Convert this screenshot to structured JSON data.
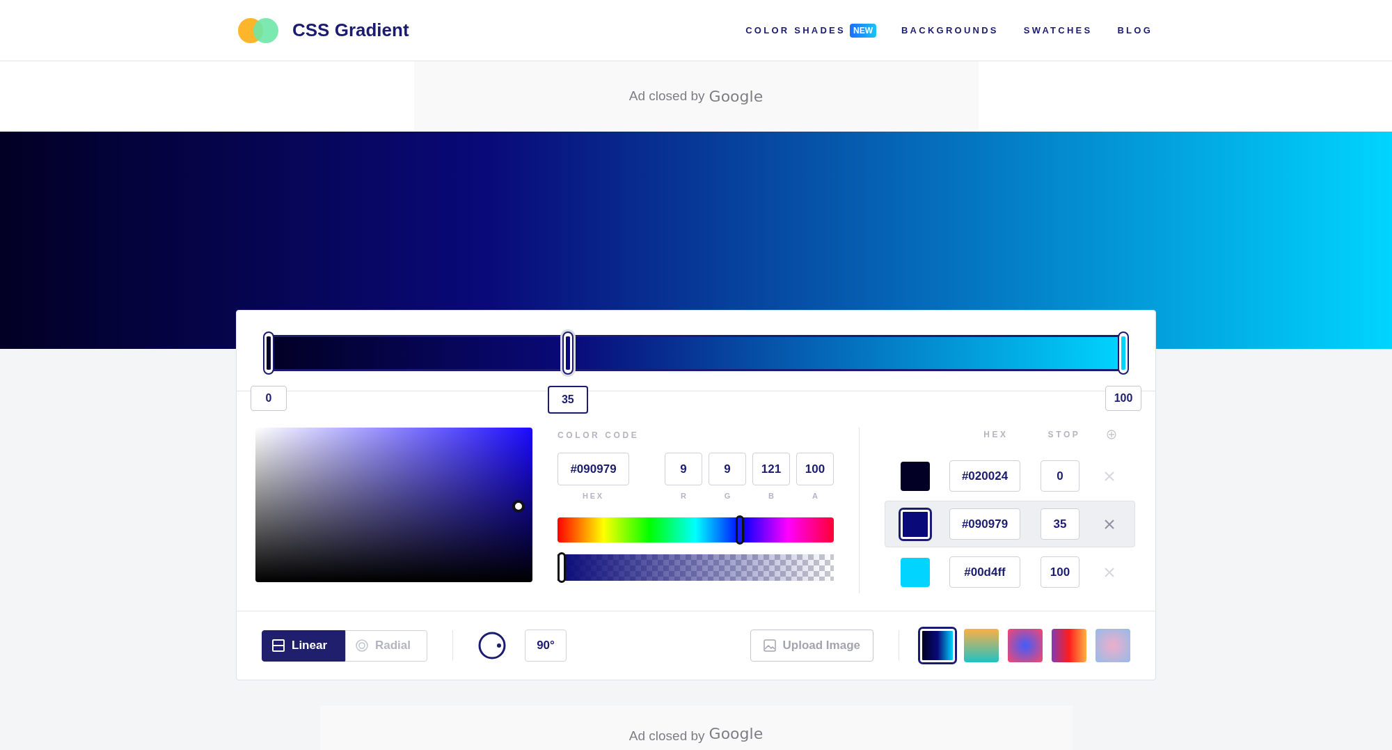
{
  "header": {
    "logo_text": "CSS Gradient",
    "nav": [
      {
        "label": "COLOR SHADES",
        "badge": "NEW"
      },
      {
        "label": "BACKGROUNDS"
      },
      {
        "label": "SWATCHES"
      },
      {
        "label": "BLOG"
      }
    ]
  },
  "ads": [
    {
      "text": "Ad closed by",
      "brand": "Google"
    },
    {
      "text": "Ad closed by",
      "brand": "Google"
    }
  ],
  "stops": [
    {
      "hex": "#020024",
      "color": "#020024",
      "marker_label": "0",
      "stop": "0",
      "level": 0,
      "selected": false
    },
    {
      "hex": "#090979",
      "color": "#090979",
      "marker_label": "35",
      "stop": "35",
      "level": 0.35,
      "selected": true
    },
    {
      "hex": "#00d4ff",
      "color": "#00d4ff",
      "marker_label": "100",
      "stop": "100",
      "level": 1,
      "selected": false
    }
  ],
  "picker": {
    "section_label": "COLOR CODE",
    "hex": "#090979",
    "hex_label": "HEX",
    "channels": [
      {
        "label": "R",
        "value": "9"
      },
      {
        "label": "G",
        "value": "9"
      },
      {
        "label": "B",
        "value": "121"
      },
      {
        "label": "A",
        "value": "100"
      }
    ],
    "hue": {
      "level": 0.66
    },
    "alpha": {
      "level": 0
    }
  },
  "stop_list": {
    "columns": [
      "HEX",
      "STOP"
    ]
  },
  "gradient_types": [
    {
      "label": "Linear",
      "kind": "linear",
      "selected": true
    },
    {
      "label": "Radial",
      "kind": "radial",
      "selected": false
    }
  ],
  "angle": "90°",
  "upload_button": "Upload Image",
  "presets": [
    {
      "selected": true
    },
    {
      "selected": false
    },
    {
      "selected": false
    },
    {
      "selected": false
    },
    {
      "selected": false
    }
  ]
}
